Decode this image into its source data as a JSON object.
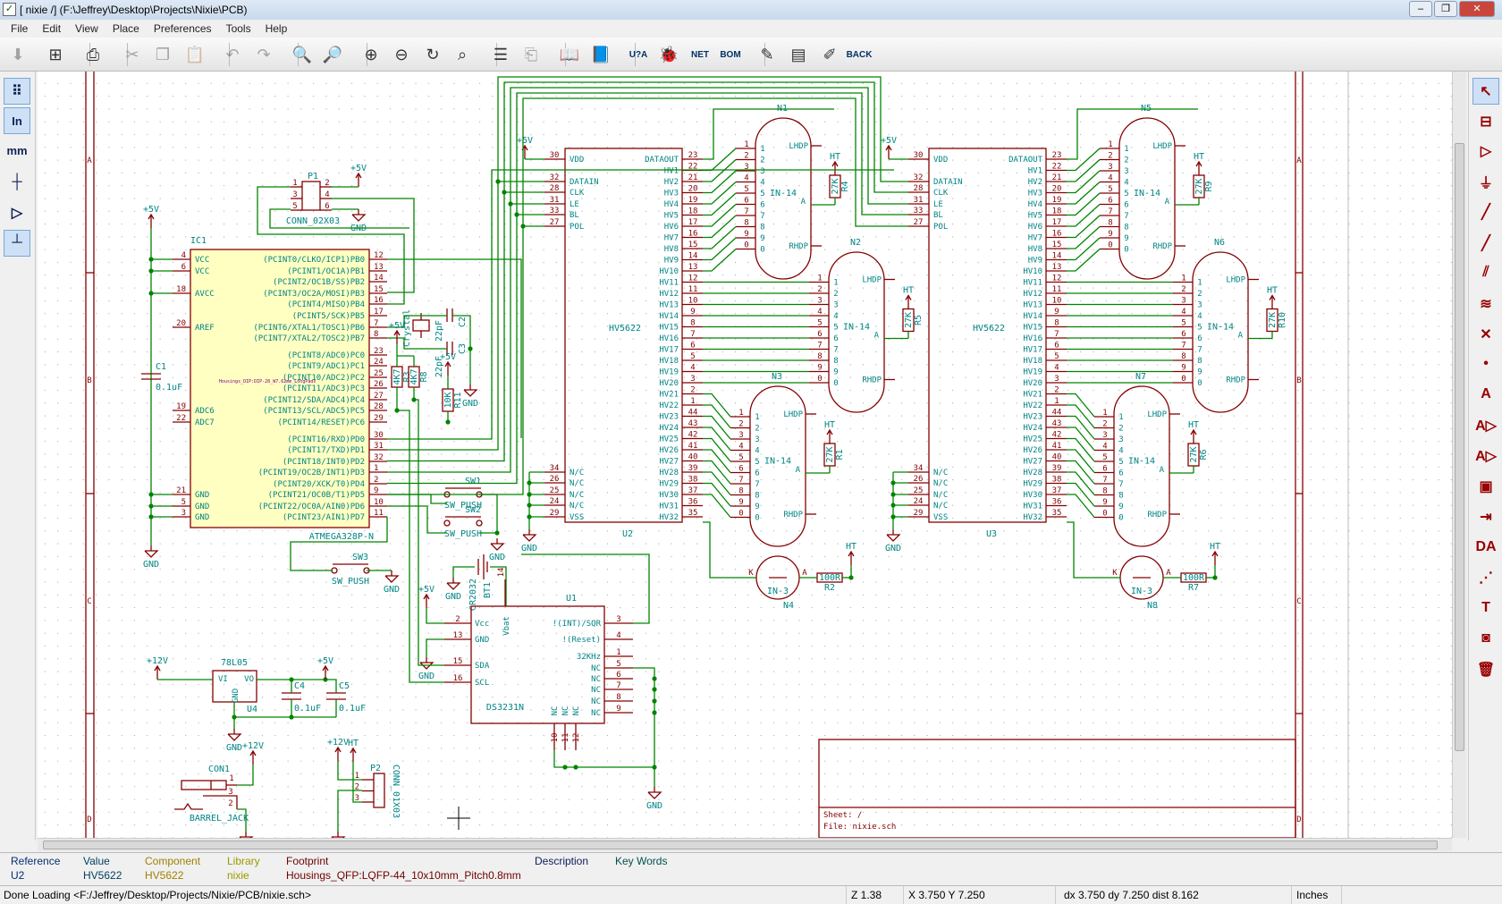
{
  "window": {
    "title": "[ nixie /] (F:\\Jeffrey\\Desktop\\Projects\\Nixie\\PCB)"
  },
  "menu": [
    "File",
    "Edit",
    "View",
    "Place",
    "Preferences",
    "Tools",
    "Help"
  ],
  "toolbar": [
    {
      "icon": "save-icon",
      "glyph": "⬇",
      "disabled": true
    },
    {
      "icon": "page-settings-icon",
      "glyph": "⊞"
    },
    {
      "sep": true
    },
    {
      "icon": "print-icon",
      "glyph": "⎙"
    },
    {
      "sep": true
    },
    {
      "icon": "cut-icon",
      "glyph": "✂",
      "disabled": true
    },
    {
      "icon": "copy-icon",
      "glyph": "❐",
      "disabled": true
    },
    {
      "icon": "paste-icon",
      "glyph": "📋",
      "disabled": true
    },
    {
      "sep": true
    },
    {
      "icon": "undo-icon",
      "glyph": "↶",
      "disabled": true
    },
    {
      "icon": "redo-icon",
      "glyph": "↷",
      "disabled": true
    },
    {
      "sep": true
    },
    {
      "icon": "find-icon",
      "glyph": "🔍"
    },
    {
      "icon": "find-replace-icon",
      "glyph": "🔎"
    },
    {
      "sep": true
    },
    {
      "icon": "zoom-in-icon",
      "glyph": "⊕"
    },
    {
      "icon": "zoom-out-icon",
      "glyph": "⊖"
    },
    {
      "icon": "redraw-icon",
      "glyph": "↻"
    },
    {
      "icon": "zoom-fit-icon",
      "glyph": "⌕"
    },
    {
      "sep": true
    },
    {
      "icon": "hierarchy-icon",
      "glyph": "☰"
    },
    {
      "icon": "leave-sheet-icon",
      "glyph": "⎗",
      "disabled": true
    },
    {
      "sep": true
    },
    {
      "icon": "library-editor-icon",
      "glyph": "📖"
    },
    {
      "icon": "library-browser-icon",
      "glyph": "📘"
    },
    {
      "sep": true
    },
    {
      "icon": "annotate-icon",
      "glyph": "U?A",
      "small": true
    },
    {
      "icon": "erc-icon",
      "glyph": "🐞"
    },
    {
      "icon": "netlist-icon",
      "glyph": "NET",
      "small": true
    },
    {
      "icon": "bom-icon",
      "glyph": "BOM",
      "small": true
    },
    {
      "sep": true
    },
    {
      "icon": "cvpcb-icon",
      "glyph": "✎"
    },
    {
      "icon": "pcbnew-icon",
      "glyph": "▤"
    },
    {
      "icon": "import-footprints-icon",
      "glyph": "✐"
    },
    {
      "icon": "back-icon",
      "glyph": "BACK",
      "small": true
    }
  ],
  "left_toolbar": [
    {
      "icon": "grid-icon",
      "glyph": "⠿",
      "active": true
    },
    {
      "icon": "inches-icon",
      "glyph": "In",
      "active": true
    },
    {
      "icon": "millimeters-icon",
      "glyph": "mm"
    },
    {
      "icon": "cursor-shape-icon",
      "glyph": "┼"
    },
    {
      "icon": "hidden-pins-icon",
      "glyph": "▷"
    },
    {
      "icon": "wire-angle-icon",
      "glyph": "┴",
      "active": true
    }
  ],
  "right_toolbar": [
    {
      "icon": "select-arrow-icon",
      "glyph": "↖",
      "active": true
    },
    {
      "icon": "hierarchy-nav-icon",
      "glyph": "⊟"
    },
    {
      "icon": "place-component-icon",
      "glyph": "▷"
    },
    {
      "icon": "place-power-icon",
      "glyph": "⏚"
    },
    {
      "icon": "wire-icon",
      "glyph": "╱"
    },
    {
      "icon": "bus-icon",
      "glyph": "╱"
    },
    {
      "icon": "bus-entry-icon",
      "glyph": "⫽"
    },
    {
      "icon": "wire-entry-icon",
      "glyph": "≋"
    },
    {
      "icon": "no-connect-icon",
      "glyph": "✕"
    },
    {
      "icon": "junction-icon",
      "glyph": "•"
    },
    {
      "icon": "net-label-icon",
      "glyph": "A"
    },
    {
      "icon": "global-label-icon",
      "glyph": "A▷"
    },
    {
      "icon": "hier-label-icon",
      "glyph": "A▷"
    },
    {
      "icon": "hier-sheet-icon",
      "glyph": "▣"
    },
    {
      "icon": "import-sheet-pin-icon",
      "glyph": "⇥"
    },
    {
      "icon": "sheet-pin-icon",
      "glyph": "DA"
    },
    {
      "icon": "graphic-line-icon",
      "glyph": "⋰"
    },
    {
      "icon": "text-icon",
      "glyph": "T"
    },
    {
      "icon": "image-icon",
      "glyph": "◙"
    },
    {
      "icon": "delete-icon",
      "glyph": "🗑"
    }
  ],
  "frame": {
    "row_letters": [
      "A",
      "B",
      "C",
      "D"
    ]
  },
  "colors": {
    "wire": "#008400",
    "component": "#840000",
    "text": "#008484",
    "body_fill": "#ffffc2"
  },
  "schematic": {
    "power": {
      "p5v": "+5V",
      "gnd": "GND",
      "p12v": "+12V",
      "ht": "HT"
    },
    "ic1": {
      "ref": "IC1",
      "value": "ATMEGA328P-N",
      "footprint": "Housings_DIP:DIP-28_W7.62mm_LongPads",
      "left": [
        [
          "4",
          "VCC"
        ],
        [
          "6",
          "VCC"
        ],
        [
          "18",
          "AVCC"
        ],
        [
          "20",
          "AREF"
        ],
        [
          "19",
          "ADC6"
        ],
        [
          "22",
          "ADC7"
        ],
        [
          "21",
          "GND"
        ],
        [
          "5",
          "GND"
        ],
        [
          "3",
          "GND"
        ]
      ],
      "right": [
        [
          "12",
          "(PCINT0/CLKO/ICP1)PB0"
        ],
        [
          "13",
          "(PCINT1/OC1A)PB1"
        ],
        [
          "14",
          "(PCINT2/OC1B/SS)PB2"
        ],
        [
          "15",
          "(PCINT3/OC2A/MOSI)PB3"
        ],
        [
          "16",
          "(PCINT4/MISO)PB4"
        ],
        [
          "17",
          "(PCINT5/SCK)PB5"
        ],
        [
          "7",
          "(PCINT6/XTAL1/TOSC1)PB6"
        ],
        [
          "8",
          "(PCINT7/XTAL2/TOSC2)PB7"
        ],
        [
          "23",
          "(PCINT8/ADC0)PC0"
        ],
        [
          "24",
          "(PCINT9/ADC1)PC1"
        ],
        [
          "25",
          "(PCINT10/ADC2)PC2"
        ],
        [
          "26",
          "(PCINT11/ADC3)PC3"
        ],
        [
          "27",
          "(PCINT12/SDA/ADC4)PC4"
        ],
        [
          "28",
          "(PCINT13/SCL/ADC5)PC5"
        ],
        [
          "29",
          "(PCINT14/RESET)PC6"
        ],
        [
          "30",
          "(PCINT16/RXD)PD0"
        ],
        [
          "31",
          "(PCINT17/TXD)PD1"
        ],
        [
          "32",
          "(PCINT18/INT0)PD2"
        ],
        [
          "1",
          "(PCINT19/OC2B/INT1)PD3"
        ],
        [
          "2",
          "(PCINT20/XCK/T0)PD4"
        ],
        [
          "9",
          "(PCINT21/OC0B/T1)PD5"
        ],
        [
          "10",
          "(PCINT22/OC0A/AIN0)PD6"
        ],
        [
          "11",
          "(PCINT23/AIN1)PD7"
        ]
      ]
    },
    "p1": {
      "ref": "P1",
      "value": "CONN_02X03",
      "pins": [
        "1",
        "2",
        "3",
        "4",
        "5",
        "6"
      ]
    },
    "c1": {
      "ref": "C1",
      "value": "0.1uF"
    },
    "crystal": {
      "value": "Crystal"
    },
    "c2": {
      "ref": "C2",
      "value": "22pF"
    },
    "c3": {
      "ref": "C3",
      "value": "22pF"
    },
    "r3": {
      "ref": "R3",
      "value": "4K7"
    },
    "r8": {
      "ref": "R8",
      "value": "4K7"
    },
    "r11": {
      "ref": "R11",
      "value": "10K"
    },
    "sw1": {
      "ref": "SW1",
      "value": "SW_PUSH"
    },
    "sw2": {
      "ref": "SW2",
      "value": "SW_PUSH"
    },
    "sw3": {
      "ref": "SW3",
      "value": "SW_PUSH"
    },
    "bt1": {
      "ref": "BT1",
      "value": "CR2032"
    },
    "hv_chips": [
      {
        "ref": "U2",
        "value": "HV5622"
      },
      {
        "ref": "U3",
        "value": "HV5622"
      }
    ],
    "hv_left": [
      [
        "30",
        "VDD"
      ],
      [
        "32",
        "DATAIN"
      ],
      [
        "28",
        "CLK"
      ],
      [
        "31",
        "LE"
      ],
      [
        "33",
        "BL"
      ],
      [
        "27",
        "POL"
      ],
      [
        "34",
        "N/C"
      ],
      [
        "26",
        "N/C"
      ],
      [
        "25",
        "N/C"
      ],
      [
        "24",
        "N/C"
      ],
      [
        "29",
        "VSS"
      ]
    ],
    "hv_right": [
      [
        "23",
        "DATAOUT"
      ],
      [
        "22",
        "HV1"
      ],
      [
        "21",
        "HV2"
      ],
      [
        "20",
        "HV3"
      ],
      [
        "19",
        "HV4"
      ],
      [
        "18",
        "HV5"
      ],
      [
        "17",
        "HV6"
      ],
      [
        "16",
        "HV7"
      ],
      [
        "15",
        "HV8"
      ],
      [
        "14",
        "HV9"
      ],
      [
        "13",
        "HV10"
      ],
      [
        "12",
        "HV11"
      ],
      [
        "11",
        "HV12"
      ],
      [
        "10",
        "HV13"
      ],
      [
        "9",
        "HV14"
      ],
      [
        "8",
        "HV15"
      ],
      [
        "7",
        "HV16"
      ],
      [
        "6",
        "HV17"
      ],
      [
        "5",
        "HV18"
      ],
      [
        "4",
        "HV19"
      ],
      [
        "3",
        "HV20"
      ],
      [
        "2",
        "HV21"
      ],
      [
        "1",
        "HV22"
      ],
      [
        "44",
        "HV23"
      ],
      [
        "43",
        "HV24"
      ],
      [
        "42",
        "HV25"
      ],
      [
        "41",
        "HV26"
      ],
      [
        "40",
        "HV27"
      ],
      [
        "39",
        "HV28"
      ],
      [
        "38",
        "HV29"
      ],
      [
        "37",
        "HV30"
      ],
      [
        "36",
        "HV31"
      ],
      [
        "35",
        "HV32"
      ]
    ],
    "tube_pins": [
      "1",
      "2",
      "3",
      "4",
      "5",
      "6",
      "7",
      "8",
      "9",
      "0"
    ],
    "tube_value": "IN-14",
    "tube_lhdp": "LHDP",
    "tube_rhdp": "RHDP",
    "tube_anode": "A",
    "tubes": [
      {
        "ref": "N1",
        "res_ref": "R4",
        "res_value": "27K"
      },
      {
        "ref": "N2",
        "res_ref": "R5",
        "res_value": "27K"
      },
      {
        "ref": "N3",
        "res_ref": "R1",
        "res_value": "27K"
      },
      {
        "ref": "N5",
        "res_ref": "R9",
        "res_value": "27K"
      },
      {
        "ref": "N6",
        "res_ref": "R10",
        "res_value": "27K"
      },
      {
        "ref": "N7",
        "res_ref": "R6",
        "res_value": "27K"
      }
    ],
    "neons": [
      {
        "ref": "N4",
        "value": "IN-3",
        "res_ref": "R2",
        "res_value": "100R"
      },
      {
        "ref": "N8",
        "value": "IN-3",
        "res_ref": "R7",
        "res_value": "100R"
      }
    ],
    "neon_pins": {
      "k": "K",
      "a": "A"
    },
    "u1": {
      "ref": "U1",
      "value": "DS3231N",
      "left": [
        [
          "2",
          "Vcc"
        ],
        [
          "13",
          "GND"
        ],
        [
          "15",
          "SDA"
        ],
        [
          "16",
          "SCL"
        ]
      ],
      "right": [
        [
          "3",
          "!(INT)/SQR"
        ],
        [
          "4",
          "!(Reset)"
        ],
        [
          "1",
          "32KHz"
        ],
        [
          "5",
          "NC"
        ],
        [
          "6",
          "NC"
        ],
        [
          "7",
          "NC"
        ],
        [
          "8",
          "NC"
        ],
        [
          "9",
          "NC"
        ]
      ],
      "top": [
        [
          "14",
          "Vbat"
        ]
      ],
      "bottom": [
        [
          "10",
          "NC"
        ],
        [
          "11",
          "NC"
        ],
        [
          "12",
          "NC"
        ]
      ]
    },
    "u4": {
      "ref": "U4",
      "value": "78L05",
      "vi": "VI",
      "vo": "VO",
      "gnd": "GND"
    },
    "c4": {
      "ref": "C4",
      "value": "0.1uF"
    },
    "c5": {
      "ref": "C5",
      "value": "0.1uF"
    },
    "con1": {
      "ref": "CON1",
      "value": "BARREL_JACK",
      "pins": [
        "1",
        "3",
        "2"
      ]
    },
    "p2": {
      "ref": "P2",
      "value": "CONN_01X03",
      "pins": [
        "1",
        "2",
        "3"
      ]
    },
    "title_block": {
      "sheet": "Sheet: /",
      "file": "File: nixie.sch"
    }
  },
  "info": {
    "headers": {
      "reference": "Reference",
      "value": "Value",
      "component": "Component",
      "library": "Library",
      "footprint": "Footprint",
      "description": "Description",
      "keywords": "Key Words"
    },
    "values": {
      "reference": "U2",
      "value": "HV5622",
      "component": "HV5622",
      "library": "nixie",
      "footprint": "Housings_QFP:LQFP-44_10x10mm_Pitch0.8mm",
      "description": "",
      "keywords": ""
    }
  },
  "status": {
    "message": "Done Loading <F:/Jeffrey/Desktop/Projects/Nixie/PCB/nixie.sch>",
    "zoom": "Z 1.38",
    "coords": "X 3.750  Y 7.250",
    "delta": "dx 3.750  dy 7.250  dist 8.162",
    "units": "Inches"
  }
}
